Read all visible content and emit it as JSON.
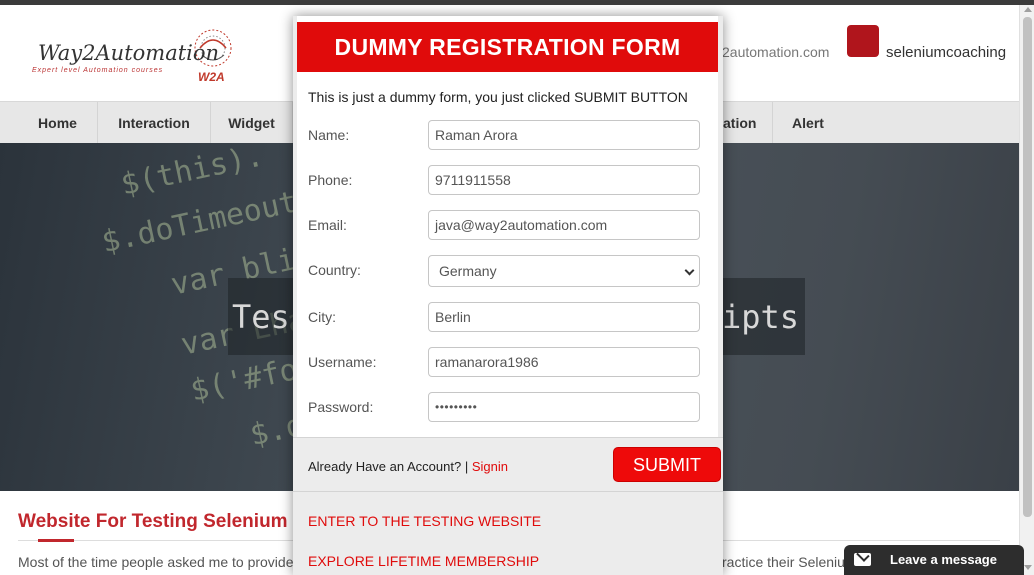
{
  "site": {
    "logo_brand": "Way2Automation",
    "logo_tagline": "Expert level Automation courses",
    "logo_mark": "W2A",
    "header_email": "2automation.com",
    "header_social": "seleniumcoaching",
    "nav": [
      "Home",
      "Interaction",
      "Widget",
      "ation",
      "Alert"
    ],
    "hero_left": "Tes",
    "hero_right": "ipts",
    "content_title": "Website For Testing Selenium",
    "content_text_left": "Most of the time people asked me to provide",
    "content_text_right": "ractice their Seleniu"
  },
  "modal": {
    "title": "DUMMY REGISTRATION FORM",
    "note": "This is just a dummy form, you just clicked SUBMIT BUTTON",
    "fields": {
      "name": {
        "label": "Name:",
        "value": "Raman Arora"
      },
      "phone": {
        "label": "Phone:",
        "value": "9711911558"
      },
      "email": {
        "label": "Email:",
        "value": "java@way2automation.com"
      },
      "country": {
        "label": "Country:",
        "value": "Germany"
      },
      "city": {
        "label": "City:",
        "value": "Berlin"
      },
      "username": {
        "label": "Username:",
        "value": "ramanarora1986"
      },
      "password": {
        "label": "Password:",
        "value": "•••••••••"
      }
    },
    "account_prompt": "Already Have an Account? | ",
    "signin": "Signin",
    "submit": "SUBMIT",
    "link_testing": "ENTER TO THE TESTING WEBSITE",
    "link_membership": "EXPLORE LIFETIME MEMBERSHIP"
  },
  "chat": {
    "label": "Leave a message"
  },
  "colors": {
    "accent_red": "#e00b0b",
    "brand_red": "#c1272d",
    "chat_bg": "#2d2d2d"
  }
}
